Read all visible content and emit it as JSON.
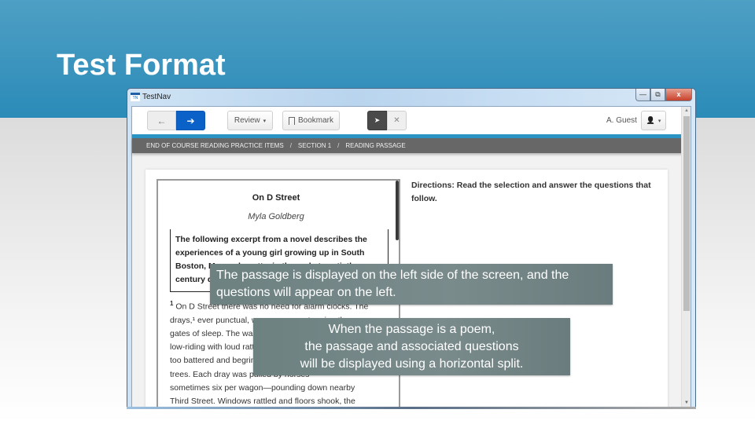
{
  "slide": {
    "title": "Test Format",
    "colors": {
      "header_blue": "#2b8bb8",
      "callout_gray": "#728586"
    }
  },
  "window": {
    "app_title": "TestNav",
    "app_icon": "TN",
    "controls": {
      "minimize": "—",
      "restore": "⧉",
      "close": "x"
    }
  },
  "toolbar": {
    "back_icon": "←",
    "next_icon": "➔",
    "review_label": "Review",
    "review_caret": "▾",
    "bookmark_label": "Bookmark",
    "pointer_icon": "➤",
    "close_tool_icon": "✕",
    "user_name": "A. Guest",
    "user_icon": "👤",
    "user_caret": "▾",
    "accent": "#0a62c8"
  },
  "breadcrumb": {
    "items": [
      "END OF COURSE READING PRACTICE ITEMS",
      "SECTION 1",
      "READING PASSAGE"
    ],
    "separator": "/"
  },
  "scrollbar": {
    "up": "▲",
    "down": "▼"
  },
  "passage": {
    "title": "On D Street",
    "author": "Myla Goldberg",
    "intro": "The following excerpt from a novel describes the experiences of a young girl growing up in South Boston, Massachusetts, in the early twentieth century during the",
    "paragraph_number": "1",
    "body_lines": [
      "On D Street there was no need for alarm clocks. The",
      "drays,¹ ever punctual, were an army storming the",
      "gates of sleep. The wagons came, ungainly and",
      "low-riding with loud rattles, the horses",
      "too battered and begrimed to notice the",
      "trees. Each dray was pulled by horses—",
      "sometimes six per wagon—pounding down nearby",
      "Third Street. Windows rattled and floors shook, the"
    ]
  },
  "directions": "Directions: Read the selection and answer the questions that follow.",
  "callouts": [
    {
      "text": "The passage is displayed on the left side of the screen, and the questions will appear on the left."
    },
    {
      "lines": [
        "When the passage is a poem,",
        "the passage and associated questions",
        "will be displayed using a horizontal split."
      ]
    }
  ]
}
